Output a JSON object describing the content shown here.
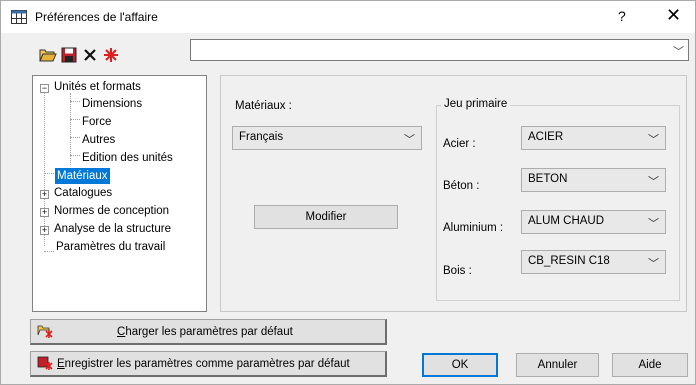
{
  "window": {
    "title": "Préférences de l'affaire",
    "help_label": "?",
    "close_label": "✕"
  },
  "toolbar": {
    "open_icon": "folder-open-icon",
    "save_icon": "floppy-icon",
    "delete_icon": "x-icon",
    "reset_icon": "red-star-icon",
    "combo_value": ""
  },
  "tree": {
    "items": [
      {
        "label": "Unités et formats",
        "expander": "−"
      },
      {
        "label": "Dimensions"
      },
      {
        "label": "Force"
      },
      {
        "label": "Autres"
      },
      {
        "label": "Edition des unités"
      },
      {
        "label": "Matériaux",
        "selected": true
      },
      {
        "label": "Catalogues",
        "expander": "+"
      },
      {
        "label": "Normes de conception",
        "expander": "+"
      },
      {
        "label": "Analyse de la structure",
        "expander": "+"
      },
      {
        "label": "Paramètres du travail"
      }
    ]
  },
  "panel": {
    "materials_label": "Matériaux :",
    "materials_value": "Français",
    "modify_button": "Modifier",
    "group_title": "Jeu primaire",
    "rows": [
      {
        "label": "Acier :",
        "value": "ACIER"
      },
      {
        "label": "Béton :",
        "value": "BETON"
      },
      {
        "label": "Aluminium :",
        "value": "ALUM CHAUD"
      },
      {
        "label": "Bois :",
        "value": "CB_RESIN C18"
      }
    ]
  },
  "bottom": {
    "load_defaults_hotkey": "C",
    "load_defaults_rest": "harger les paramètres par défaut",
    "save_defaults_hotkey": "E",
    "save_defaults_rest": "nregistrer les paramètres comme paramètres par défaut",
    "ok": "OK",
    "cancel": "Annuler",
    "help": "Aide"
  },
  "colors": {
    "selection": "#0078d7",
    "accent_red": "#e02020"
  }
}
